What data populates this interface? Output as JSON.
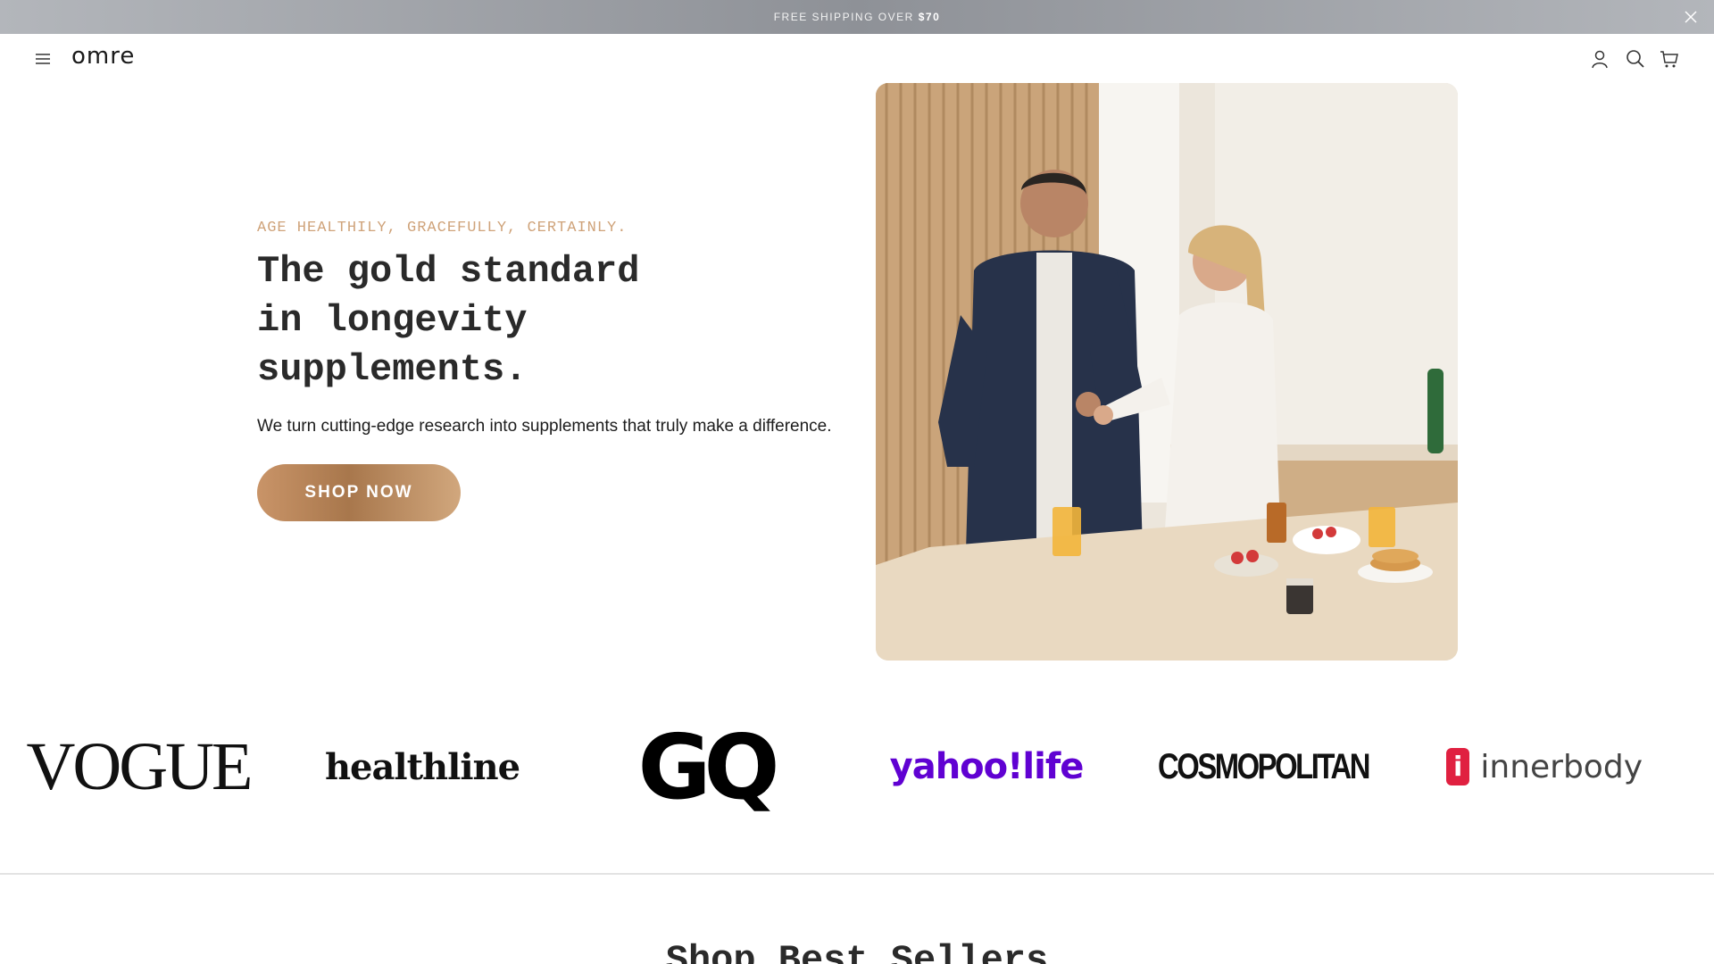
{
  "announcement": {
    "text": "FREE SHIPPING OVER",
    "amount": "$70",
    "close_icon": "close-icon"
  },
  "header": {
    "logo": "omre",
    "menu_icon": "hamburger-menu-icon",
    "icons": [
      "account-icon",
      "search-icon",
      "cart-icon"
    ]
  },
  "hero": {
    "eyebrow": "AGE HEALTHILY, GRACEFULLY, CERTAINLY.",
    "headline_line1": "The gold standard",
    "headline_line2": "in longevity",
    "headline_line3": "supplements.",
    "subtext": "We turn cutting-edge research into supplements that truly make a difference.",
    "cta": "SHOP NOW",
    "cta_color": "#b8855a",
    "eyebrow_color": "#cfa37a"
  },
  "press": {
    "vogue": "VOGUE",
    "healthline": "healthline",
    "gq": "GQ",
    "yahoo": "yahoo!",
    "yahoo_life": "life",
    "cosmopolitan": "COSMOPOLITAN",
    "innerbody_mark": "i",
    "innerbody": "innerbody"
  },
  "section": {
    "title": "Shop Best Sellers"
  }
}
